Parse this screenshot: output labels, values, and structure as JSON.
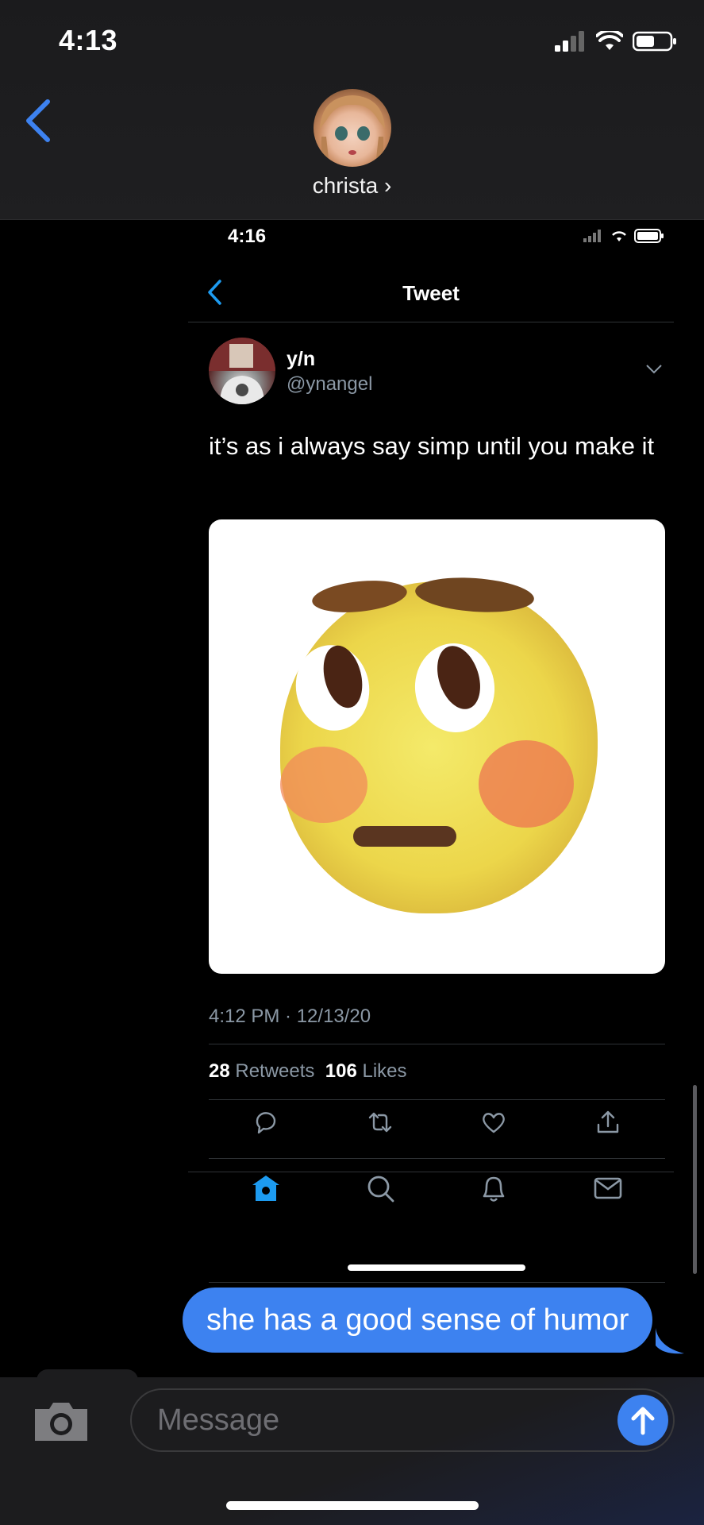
{
  "status_bar": {
    "time": "4:13"
  },
  "contact": {
    "name": "christa ›"
  },
  "tweet_screenshot": {
    "status_time": "4:16",
    "nav_title": "Tweet",
    "author_name": "y/n",
    "author_handle": "@ynangel",
    "text": "it’s as i always say simp until you make it",
    "timestamp": "4:12 PM · 12/13/20",
    "retweets_count": "28",
    "retweets_label": "Retweets",
    "likes_count": "106",
    "likes_label": "Likes",
    "icons": {
      "actions": [
        "reply-icon",
        "retweet-icon",
        "like-icon",
        "share-icon"
      ],
      "tabs": [
        "home-icon",
        "search-icon",
        "notifications-icon",
        "messages-icon"
      ]
    }
  },
  "message": {
    "text": "she has a good sense of humor"
  },
  "compose": {
    "placeholder": "Message"
  },
  "colors": {
    "imessage_blue": "#3d82f0",
    "twitter_blue": "#1d9bf0",
    "muted": "#8b98a5"
  }
}
